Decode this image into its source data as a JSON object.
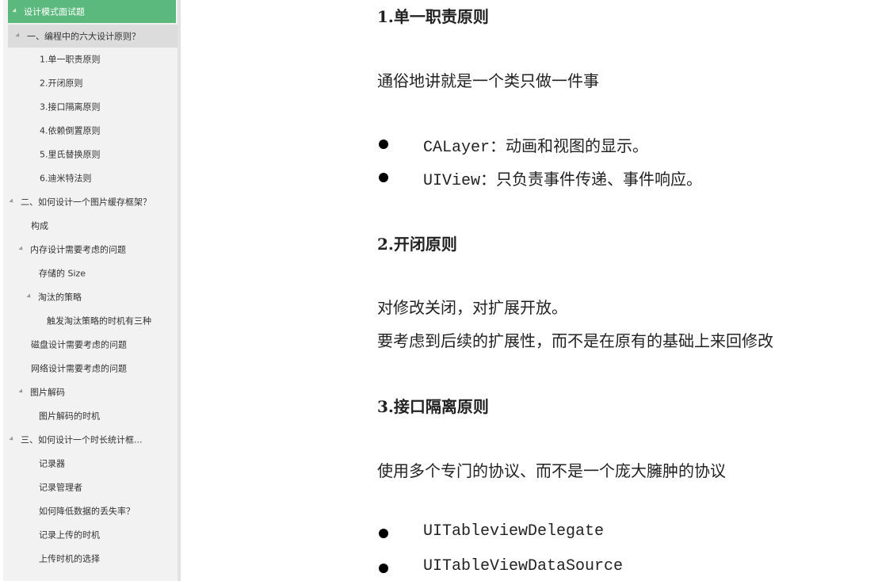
{
  "toc": {
    "items": [
      {
        "label": "设计模式面试题",
        "expandable": true
      },
      {
        "label": "一、编程中的六大设计原则？",
        "expandable": true
      },
      {
        "label": "1.单一职责原则",
        "expandable": false
      },
      {
        "label": "2.开闭原则",
        "expandable": false
      },
      {
        "label": "3.接口隔离原则",
        "expandable": false
      },
      {
        "label": "4.依赖倒置原则",
        "expandable": false
      },
      {
        "label": "5.里氏替换原则",
        "expandable": false
      },
      {
        "label": "6.迪米特法则",
        "expandable": false
      },
      {
        "label": "二、如何设计一个图片缓存框架？",
        "expandable": true
      },
      {
        "label": "构成",
        "expandable": false
      },
      {
        "label": "内存设计需要考虑的问题",
        "expandable": true
      },
      {
        "label": "存储的 Size",
        "expandable": false
      },
      {
        "label": "淘汰的策略",
        "expandable": true
      },
      {
        "label": "触发淘汰策略的时机有三种",
        "expandable": false
      },
      {
        "label": "磁盘设计需要考虑的问题",
        "expandable": false
      },
      {
        "label": "网络设计需要考虑的问题",
        "expandable": false
      },
      {
        "label": "图片解码",
        "expandable": true
      },
      {
        "label": "图片解码的时机",
        "expandable": false
      },
      {
        "label": "三、如何设计一个时长统计框...",
        "expandable": true
      },
      {
        "label": "记录器",
        "expandable": false
      },
      {
        "label": "记录管理者",
        "expandable": false
      },
      {
        "label": "如何降低数据的丢失率？",
        "expandable": false
      },
      {
        "label": "记录上传的时机",
        "expandable": false
      },
      {
        "label": "上传时机的选择",
        "expandable": false
      }
    ]
  },
  "content": {
    "s1_heading": "1.单一职责原则",
    "s1_para": "通俗地讲就是一个类只做一件事",
    "s1_bullets": [
      {
        "code": "CALayer",
        "desc": "：动画和视图的显示。"
      },
      {
        "code": "UIView",
        "desc": "：只负责事件传递、事件响应。"
      }
    ],
    "s2_heading": "2.开闭原则",
    "s2_para1": "对修改关闭，对扩展开放。",
    "s2_para2": "要考虑到后续的扩展性，而不是在原有的基础上来回修改",
    "s3_heading": "3.接口隔离原则",
    "s3_para": "使用多个专门的协议、而不是一个庞大臃肿的协议",
    "s3_bullets": [
      {
        "code": "UITableviewDelegate"
      },
      {
        "code": "UITableViewDataSource"
      }
    ]
  },
  "colors": {
    "accent": "#5cb97d",
    "sidebar_bg": "#f2f2f2",
    "active_bg": "#dcdcdc"
  }
}
